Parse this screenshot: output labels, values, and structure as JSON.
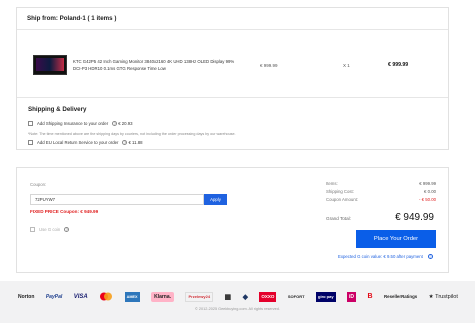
{
  "shipping": {
    "header": "Ship from: Poland-1 ( 1 items )",
    "product": {
      "name": "KTC G42P5 42 Inch Gaming Monitor 3840x2160 4K UHD 138Hz OLED Display 99% DCI-P3 HDR10 0.1ms GTG Response Time Low",
      "price": "€ 999.99",
      "qty": "X 1",
      "total": "€ 999.99"
    },
    "delivery": {
      "title": "Shipping & Delivery",
      "insurance_label": "Add Shipping Insurance to your order",
      "insurance_price": "€ 20.93",
      "note": "*Note: The time mentioned above are the shipping days by couriers, not including the order processing days by our warehouse.",
      "return_label": "Add EU Local Return Service to your order",
      "return_price": "€ 11.88"
    }
  },
  "order": {
    "coupon_label": "Coupon:",
    "coupon_value": "72PUYW7",
    "apply_label": "Apply",
    "coupon_applied": "FIXED PRICE Coupon: € 949.99",
    "gc_label": "Use G coin",
    "summary": [
      {
        "label": "Items:",
        "value": "€ 999.99",
        "red": false
      },
      {
        "label": "Shipping Cost:",
        "value": "€ 0.00",
        "red": false
      },
      {
        "label": "Coupon Amount:",
        "value": "- € 50.00",
        "red": true
      }
    ],
    "grand_label": "Grand Total:",
    "grand_value": "€ 949.99",
    "place_order_label": "Place Your Order",
    "gc_expected": "Expected G coin value: € 9.50 after payment"
  },
  "footer": {
    "payment_logos": [
      {
        "name": "Norton",
        "text": "Norton",
        "color": "#333333"
      },
      {
        "name": "PayPal",
        "text": "PayPal",
        "color": "#1c3d8c"
      },
      {
        "name": "Visa",
        "text": "VISA",
        "color": "#1a1f71"
      },
      {
        "name": "Mastercard",
        "text": "",
        "color": "#eb001b"
      },
      {
        "name": "AmericanExpress",
        "text": "AMEX",
        "color": "#2e77bb"
      },
      {
        "name": "Klarna",
        "text": "Klarna.",
        "color": "#111111"
      },
      {
        "name": "Przelewy24",
        "text": "Przelewy24",
        "color": "#d13239"
      },
      {
        "name": "Bank",
        "text": "▦",
        "color": "#333333"
      },
      {
        "name": "Bancontact",
        "text": "◆",
        "color": "#1e3764"
      },
      {
        "name": "OXXO",
        "text": "OXXO",
        "color": "#e4002b"
      },
      {
        "name": "Sofort",
        "text": "SOFORT",
        "color": "#333333"
      },
      {
        "name": "Giropay",
        "text": "giro pay",
        "color": "#000268"
      },
      {
        "name": "iDEAL",
        "text": "iD",
        "color": "#cc0066"
      },
      {
        "name": "Boleto",
        "text": "B",
        "color": "#e30613"
      },
      {
        "name": "ResellerRatings",
        "text": "ResellerRatings",
        "color": "#333333"
      },
      {
        "name": "Trustpilot",
        "text": "★ Trustpilot",
        "color": "#191919"
      }
    ],
    "copyright": "© 2012-2025 Geekbuying.com. All rights reserved."
  }
}
